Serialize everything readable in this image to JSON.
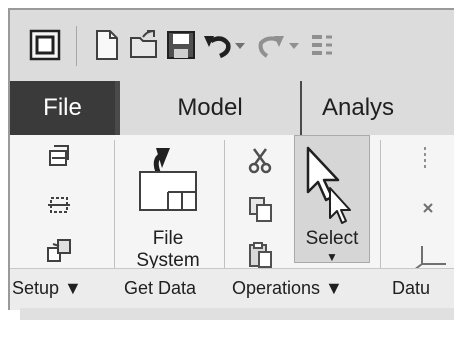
{
  "tabs": [
    {
      "label": "File"
    },
    {
      "label": "Model"
    },
    {
      "label": "Analys"
    }
  ],
  "ribbon": {
    "file_system_label_line1": "File",
    "file_system_label_line2": "System",
    "select_label": "Select",
    "select_arrow": "▼"
  },
  "groups": [
    {
      "label": "Setup ▼"
    },
    {
      "label": "Get Data"
    },
    {
      "label": "Operations ▼"
    },
    {
      "label": "Datu"
    }
  ],
  "quick_access": {
    "icons": [
      "window-icon",
      "new-file-icon",
      "open-folder-icon",
      "save-icon",
      "undo-icon",
      "undo-dropdown-icon",
      "redo-icon",
      "redo-dropdown-icon",
      "regenerate-icon"
    ]
  }
}
